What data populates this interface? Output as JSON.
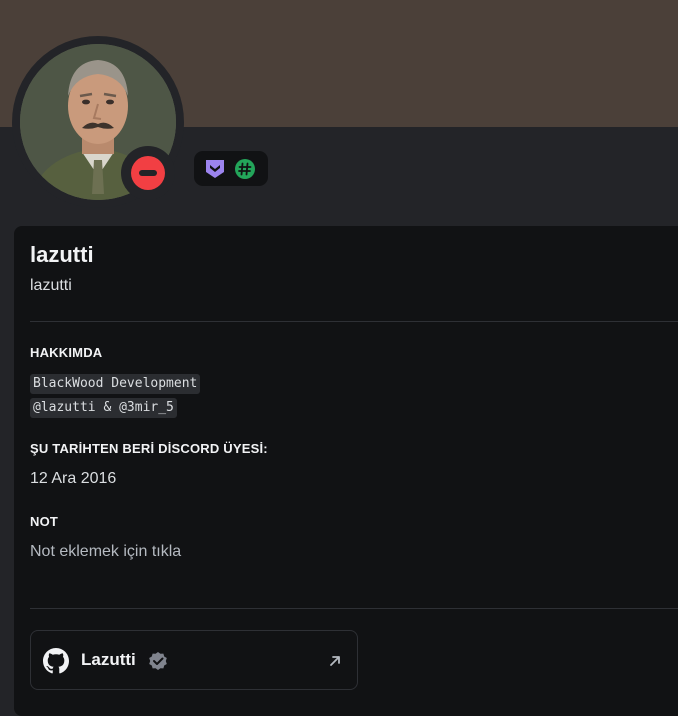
{
  "profile": {
    "display_name": "lazutti",
    "username": "lazutti",
    "status": "dnd",
    "status_color": "#f23f43",
    "banner_color": "#4b4039"
  },
  "badges": [
    {
      "icon": "hypesquad-icon",
      "color": "#9c84ef"
    },
    {
      "icon": "hashtag-badge-icon",
      "color": "#23a55a"
    }
  ],
  "about": {
    "title": "HAKKIMDA",
    "lines": [
      "BlackWood Development",
      "@lazutti & @3mir_5"
    ]
  },
  "member_since": {
    "title": "ŞU TARİHTEN BERİ DİSCORD ÜYESİ:",
    "date": "12 Ara 2016"
  },
  "note": {
    "title": "NOT",
    "placeholder": "Not eklemek için tıkla"
  },
  "connection": {
    "icon": "github-icon",
    "name": "Lazutti",
    "verified": true
  }
}
